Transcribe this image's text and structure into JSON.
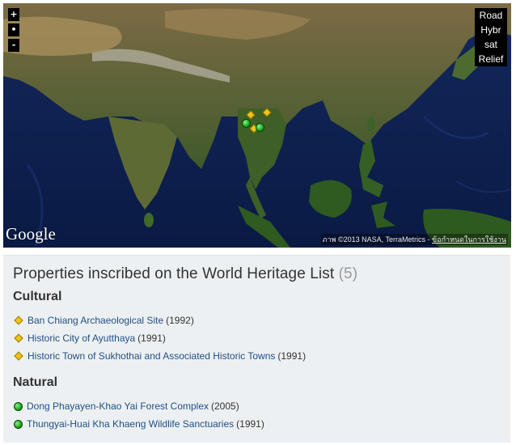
{
  "map": {
    "zoom_in": "+",
    "zoom_reset": "•",
    "zoom_out": "-",
    "map_types": [
      "Road",
      "Hybr",
      "sat",
      "Relief"
    ],
    "logo": "Google",
    "attribution": "ภาพ ©2013 NASA, TerraMetrics -",
    "terms_link": "ข้อกำหนดในการใช้งาน"
  },
  "panel": {
    "title": "Properties inscribed on the World Heritage List",
    "count": "(5)",
    "cultural_heading": "Cultural",
    "natural_heading": "Natural",
    "cultural": [
      {
        "name": "Ban Chiang Archaeological Site",
        "year": "(1992)"
      },
      {
        "name": "Historic City of Ayutthaya",
        "year": "(1991)"
      },
      {
        "name": "Historic Town of Sukhothai and Associated Historic Towns",
        "year": "(1991)"
      }
    ],
    "natural": [
      {
        "name": "Dong Phayayen-Khao Yai Forest Complex",
        "year": "(2005)"
      },
      {
        "name": "Thungyai-Huai Kha Khaeng Wildlife Sanctuaries",
        "year": "(1991)"
      }
    ]
  },
  "colors": {
    "cultural_marker": "#f2c318",
    "natural_marker": "#1aa61a",
    "link": "#1f4f87",
    "panel_bg": "#edf0f2"
  },
  "icons": {
    "cultural": "yellow-diamond-icon",
    "natural": "green-circle-icon"
  }
}
